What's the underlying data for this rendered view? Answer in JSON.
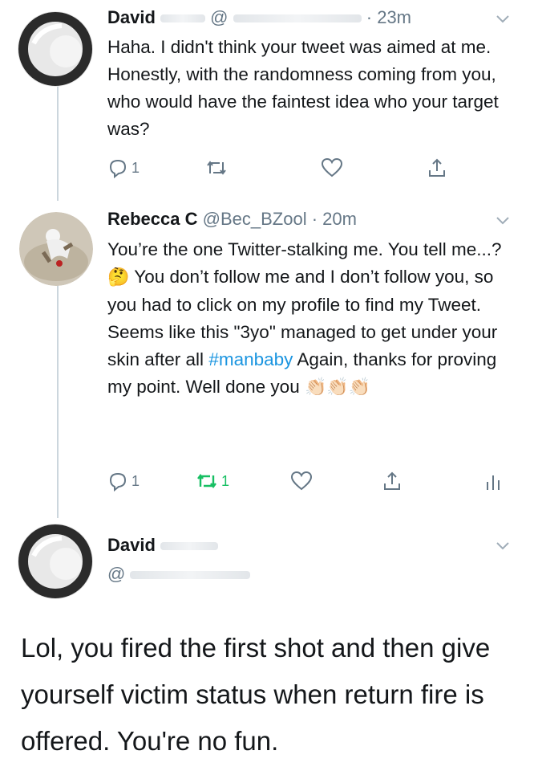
{
  "tweets": [
    {
      "name": "David",
      "handle_prefix": "@",
      "time_suffix": "· 23m",
      "text": "Haha. I didn't think your tweet was aimed at me. Honestly, with the randomness coming from you, who would have the faintest idea who your target was?",
      "reply_count": "1",
      "retweet_count": "",
      "like_count": ""
    },
    {
      "name": "Rebecca C",
      "handle": "@Bec_BZool",
      "time": "· 20m",
      "text_part1": "You’re the one Twitter-stalking me. You tell me...? ",
      "emoji_thinking": "🤔",
      "text_part2": " You don’t follow me and I don’t follow you, so you had to click on my profile to find my Tweet. Seems like this \"3yo\" managed to get under your skin after all ",
      "hashtag": "#manbaby",
      "text_part3": " Again, thanks for proving my point. Well done you ",
      "emoji_clap": "👏🏻👏🏻👏🏻",
      "reply_count": "1",
      "retweet_count": "1",
      "like_count": ""
    },
    {
      "name": "David",
      "handle_prefix": "@",
      "text": "Lol, you fired the first shot and then give yourself victim status when return fire is offered. You're no fun."
    }
  ],
  "icons": {
    "reply": "reply-icon",
    "retweet": "retweet-icon",
    "like": "heart-icon",
    "share": "share-icon",
    "analytics": "analytics-icon",
    "caret": "chevron-down-icon"
  },
  "colors": {
    "text": "#14171a",
    "secondary": "#657786",
    "hashtag": "#1b95e0",
    "retweet_active": "#17bf63",
    "thread_line": "#ccd6dd"
  }
}
